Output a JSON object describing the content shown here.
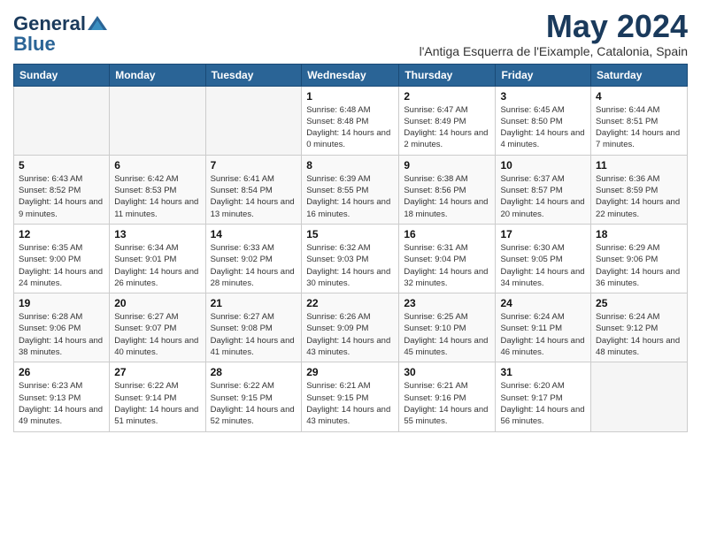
{
  "header": {
    "logo_general": "General",
    "logo_blue": "Blue",
    "month_title": "May 2024",
    "location": "l'Antiga Esquerra de l'Eixample, Catalonia, Spain"
  },
  "days_of_week": [
    "Sunday",
    "Monday",
    "Tuesday",
    "Wednesday",
    "Thursday",
    "Friday",
    "Saturday"
  ],
  "weeks": [
    [
      {
        "day": "",
        "sunrise": "",
        "sunset": "",
        "daylight": "",
        "empty": true
      },
      {
        "day": "",
        "sunrise": "",
        "sunset": "",
        "daylight": "",
        "empty": true
      },
      {
        "day": "",
        "sunrise": "",
        "sunset": "",
        "daylight": "",
        "empty": true
      },
      {
        "day": "1",
        "sunrise": "Sunrise: 6:48 AM",
        "sunset": "Sunset: 8:48 PM",
        "daylight": "Daylight: 14 hours and 0 minutes.",
        "empty": false
      },
      {
        "day": "2",
        "sunrise": "Sunrise: 6:47 AM",
        "sunset": "Sunset: 8:49 PM",
        "daylight": "Daylight: 14 hours and 2 minutes.",
        "empty": false
      },
      {
        "day": "3",
        "sunrise": "Sunrise: 6:45 AM",
        "sunset": "Sunset: 8:50 PM",
        "daylight": "Daylight: 14 hours and 4 minutes.",
        "empty": false
      },
      {
        "day": "4",
        "sunrise": "Sunrise: 6:44 AM",
        "sunset": "Sunset: 8:51 PM",
        "daylight": "Daylight: 14 hours and 7 minutes.",
        "empty": false
      }
    ],
    [
      {
        "day": "5",
        "sunrise": "Sunrise: 6:43 AM",
        "sunset": "Sunset: 8:52 PM",
        "daylight": "Daylight: 14 hours and 9 minutes.",
        "empty": false
      },
      {
        "day": "6",
        "sunrise": "Sunrise: 6:42 AM",
        "sunset": "Sunset: 8:53 PM",
        "daylight": "Daylight: 14 hours and 11 minutes.",
        "empty": false
      },
      {
        "day": "7",
        "sunrise": "Sunrise: 6:41 AM",
        "sunset": "Sunset: 8:54 PM",
        "daylight": "Daylight: 14 hours and 13 minutes.",
        "empty": false
      },
      {
        "day": "8",
        "sunrise": "Sunrise: 6:39 AM",
        "sunset": "Sunset: 8:55 PM",
        "daylight": "Daylight: 14 hours and 16 minutes.",
        "empty": false
      },
      {
        "day": "9",
        "sunrise": "Sunrise: 6:38 AM",
        "sunset": "Sunset: 8:56 PM",
        "daylight": "Daylight: 14 hours and 18 minutes.",
        "empty": false
      },
      {
        "day": "10",
        "sunrise": "Sunrise: 6:37 AM",
        "sunset": "Sunset: 8:57 PM",
        "daylight": "Daylight: 14 hours and 20 minutes.",
        "empty": false
      },
      {
        "day": "11",
        "sunrise": "Sunrise: 6:36 AM",
        "sunset": "Sunset: 8:59 PM",
        "daylight": "Daylight: 14 hours and 22 minutes.",
        "empty": false
      }
    ],
    [
      {
        "day": "12",
        "sunrise": "Sunrise: 6:35 AM",
        "sunset": "Sunset: 9:00 PM",
        "daylight": "Daylight: 14 hours and 24 minutes.",
        "empty": false
      },
      {
        "day": "13",
        "sunrise": "Sunrise: 6:34 AM",
        "sunset": "Sunset: 9:01 PM",
        "daylight": "Daylight: 14 hours and 26 minutes.",
        "empty": false
      },
      {
        "day": "14",
        "sunrise": "Sunrise: 6:33 AM",
        "sunset": "Sunset: 9:02 PM",
        "daylight": "Daylight: 14 hours and 28 minutes.",
        "empty": false
      },
      {
        "day": "15",
        "sunrise": "Sunrise: 6:32 AM",
        "sunset": "Sunset: 9:03 PM",
        "daylight": "Daylight: 14 hours and 30 minutes.",
        "empty": false
      },
      {
        "day": "16",
        "sunrise": "Sunrise: 6:31 AM",
        "sunset": "Sunset: 9:04 PM",
        "daylight": "Daylight: 14 hours and 32 minutes.",
        "empty": false
      },
      {
        "day": "17",
        "sunrise": "Sunrise: 6:30 AM",
        "sunset": "Sunset: 9:05 PM",
        "daylight": "Daylight: 14 hours and 34 minutes.",
        "empty": false
      },
      {
        "day": "18",
        "sunrise": "Sunrise: 6:29 AM",
        "sunset": "Sunset: 9:06 PM",
        "daylight": "Daylight: 14 hours and 36 minutes.",
        "empty": false
      }
    ],
    [
      {
        "day": "19",
        "sunrise": "Sunrise: 6:28 AM",
        "sunset": "Sunset: 9:06 PM",
        "daylight": "Daylight: 14 hours and 38 minutes.",
        "empty": false
      },
      {
        "day": "20",
        "sunrise": "Sunrise: 6:27 AM",
        "sunset": "Sunset: 9:07 PM",
        "daylight": "Daylight: 14 hours and 40 minutes.",
        "empty": false
      },
      {
        "day": "21",
        "sunrise": "Sunrise: 6:27 AM",
        "sunset": "Sunset: 9:08 PM",
        "daylight": "Daylight: 14 hours and 41 minutes.",
        "empty": false
      },
      {
        "day": "22",
        "sunrise": "Sunrise: 6:26 AM",
        "sunset": "Sunset: 9:09 PM",
        "daylight": "Daylight: 14 hours and 43 minutes.",
        "empty": false
      },
      {
        "day": "23",
        "sunrise": "Sunrise: 6:25 AM",
        "sunset": "Sunset: 9:10 PM",
        "daylight": "Daylight: 14 hours and 45 minutes.",
        "empty": false
      },
      {
        "day": "24",
        "sunrise": "Sunrise: 6:24 AM",
        "sunset": "Sunset: 9:11 PM",
        "daylight": "Daylight: 14 hours and 46 minutes.",
        "empty": false
      },
      {
        "day": "25",
        "sunrise": "Sunrise: 6:24 AM",
        "sunset": "Sunset: 9:12 PM",
        "daylight": "Daylight: 14 hours and 48 minutes.",
        "empty": false
      }
    ],
    [
      {
        "day": "26",
        "sunrise": "Sunrise: 6:23 AM",
        "sunset": "Sunset: 9:13 PM",
        "daylight": "Daylight: 14 hours and 49 minutes.",
        "empty": false
      },
      {
        "day": "27",
        "sunrise": "Sunrise: 6:22 AM",
        "sunset": "Sunset: 9:14 PM",
        "daylight": "Daylight: 14 hours and 51 minutes.",
        "empty": false
      },
      {
        "day": "28",
        "sunrise": "Sunrise: 6:22 AM",
        "sunset": "Sunset: 9:15 PM",
        "daylight": "Daylight: 14 hours and 52 minutes.",
        "empty": false
      },
      {
        "day": "29",
        "sunrise": "Sunrise: 6:21 AM",
        "sunset": "Sunset: 9:15 PM",
        "daylight": "Daylight: 14 hours and 43 minutes.",
        "empty": false
      },
      {
        "day": "30",
        "sunrise": "Sunrise: 6:21 AM",
        "sunset": "Sunset: 9:16 PM",
        "daylight": "Daylight: 14 hours and 55 minutes.",
        "empty": false
      },
      {
        "day": "31",
        "sunrise": "Sunrise: 6:20 AM",
        "sunset": "Sunset: 9:17 PM",
        "daylight": "Daylight: 14 hours and 56 minutes.",
        "empty": false
      },
      {
        "day": "",
        "sunrise": "",
        "sunset": "",
        "daylight": "",
        "empty": true
      }
    ]
  ]
}
